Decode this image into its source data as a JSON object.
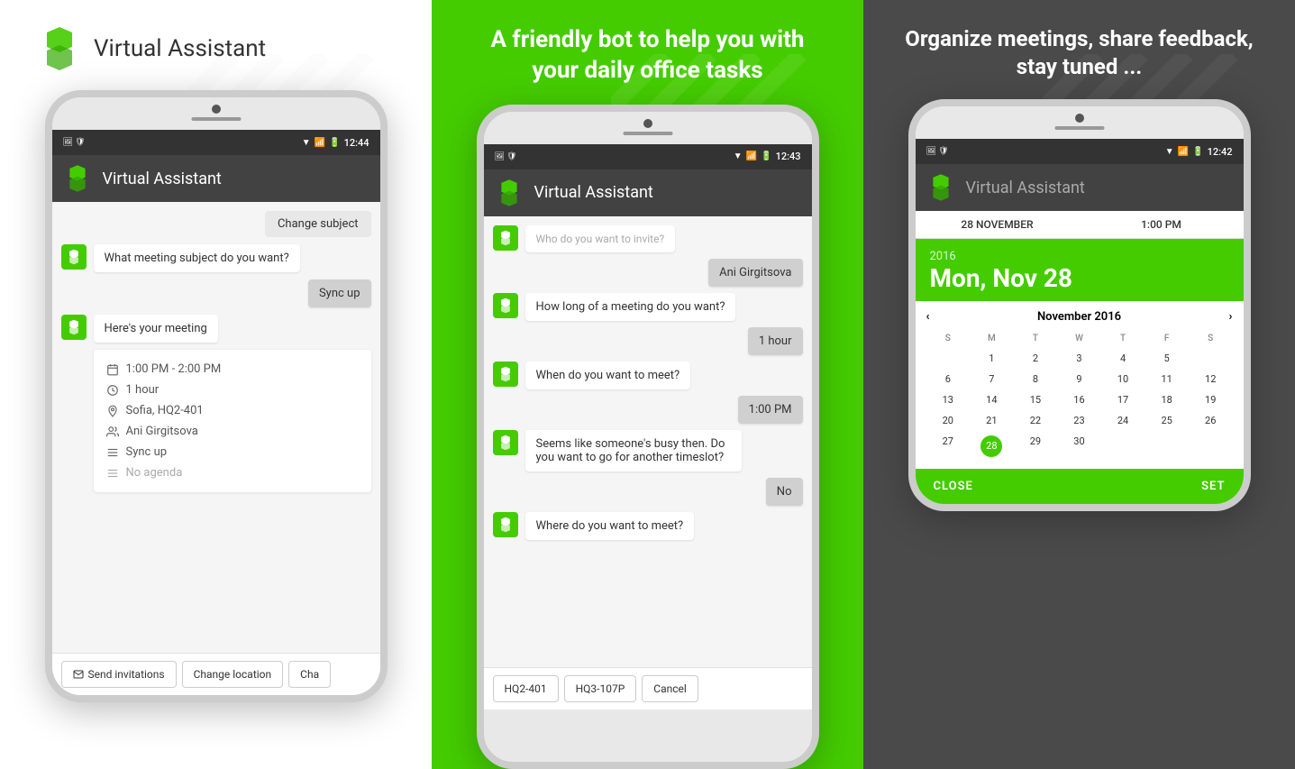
{
  "panel1": {
    "logo_text": "Virtual Assistant",
    "status_time": "12:44",
    "toolbar_title": "Virtual Assistant",
    "chat_change_subject": "Change subject",
    "chat_1": "What meeting subject do you want?",
    "chat_sync_up": "Sync up",
    "chat_heres_meeting": "Here's your meeting",
    "meeting_time": "1:00 PM - 2:00 PM",
    "meeting_duration": "1 hour",
    "meeting_location": "Sofia, HQ2-401",
    "meeting_attendee": "Ani Girgitsova",
    "meeting_cal": "Sync up",
    "meeting_agenda": "No agenda",
    "btn_send_invitations": "Send invitations",
    "btn_change_location": "Change location",
    "btn_cha": "Cha"
  },
  "panel2": {
    "header": "A friendly bot to help you with your daily office tasks",
    "status_time": "12:43",
    "toolbar_title": "Virtual Assistant",
    "chat_who_invite": "Who do you want to invite?",
    "chat_ani": "Ani Girgitsova",
    "chat_how_long": "How long of a meeting do you want?",
    "chat_1hour": "1 hour",
    "chat_when_meet": "When do you want to meet?",
    "chat_1pm": "1:00 PM",
    "chat_busy": "Seems like someone's busy then. Do you want to go for another timeslot?",
    "chat_no": "No",
    "chat_where_meet": "Where do you want to meet?",
    "btn_hq2": "HQ2-401",
    "btn_hq3": "HQ3-107P",
    "btn_cancel": "Cancel"
  },
  "panel3": {
    "header": "Organize meetings, share feedback, stay tuned ...",
    "status_time": "12:42",
    "toolbar_title": "Virtual Assistant",
    "date_label": "28 NOVEMBER",
    "time_label": "1:00 PM",
    "cal_year": "2016",
    "cal_date": "Mon, Nov 28",
    "cal_month_header": "November 2016",
    "cal_days": [
      "S",
      "M",
      "T",
      "W",
      "T",
      "F",
      "S"
    ],
    "cal_weeks": [
      [
        "",
        "1",
        "2",
        "3",
        "4",
        "5"
      ],
      [
        "6",
        "7",
        "8",
        "9",
        "10",
        "11",
        "12"
      ],
      [
        "13",
        "14",
        "15",
        "16",
        "17",
        "18",
        "19"
      ],
      [
        "20",
        "21",
        "22",
        "23",
        "24",
        "25",
        "26"
      ],
      [
        "27",
        "28",
        "29",
        "30",
        "",
        "",
        ""
      ]
    ],
    "btn_close": "CLOSE",
    "btn_set": "SET"
  }
}
